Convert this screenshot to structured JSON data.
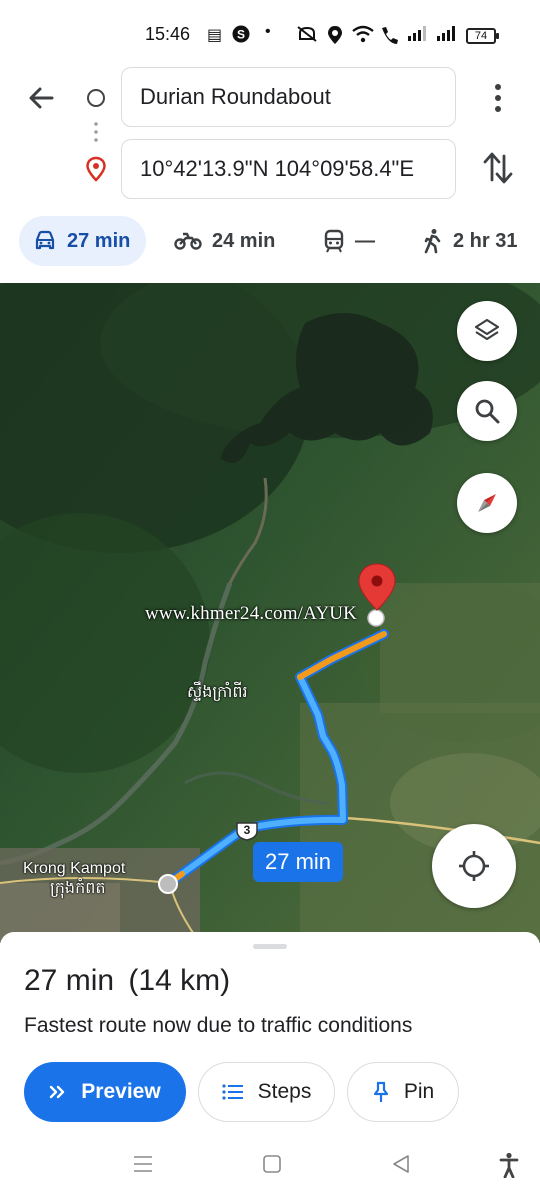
{
  "status_bar": {
    "time": "15:46",
    "battery": "74"
  },
  "header": {
    "origin": "Durian Roundabout",
    "destination": "10°42'13.9\"N 104°09'58.4\"E"
  },
  "modes": [
    {
      "name": "car",
      "label": "27 min",
      "active": true
    },
    {
      "name": "motorcycle",
      "label": "24 min",
      "active": false
    },
    {
      "name": "transit",
      "label": "—",
      "active": false
    },
    {
      "name": "walk",
      "label": "2 hr 31",
      "active": false
    }
  ],
  "map": {
    "watermark": "www.khmer24.com/AYUK",
    "place_village": "ស្ទឹងក្រាំពីរ",
    "place_city_en": "Krong Kampot",
    "place_city_km": "ក្រុងកំពត",
    "route_label": "27 min",
    "highway_number": "3"
  },
  "sheet": {
    "duration": "27 min",
    "distance": "(14 km)",
    "reason": "Fastest route now due to traffic conditions",
    "preview_label": "Preview",
    "steps_label": "Steps",
    "pin_label": "Pin"
  },
  "colors": {
    "accent": "#1a73e8",
    "route": "#4aa3f0",
    "traffic": "#f29a1c",
    "destination_pin": "#e53935"
  }
}
